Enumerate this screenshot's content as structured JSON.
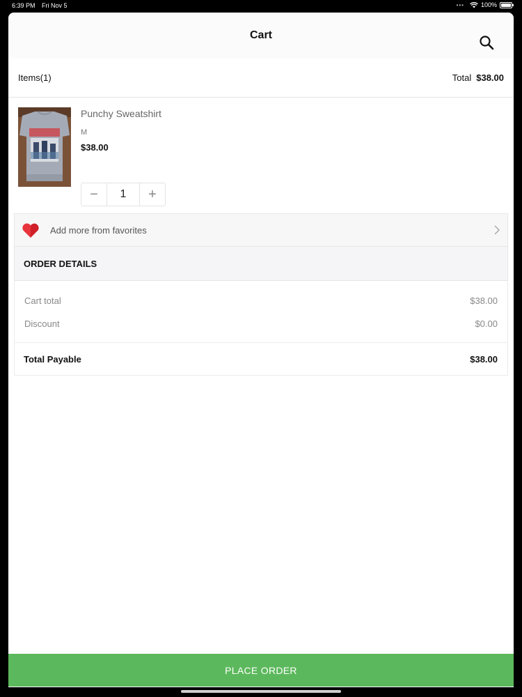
{
  "status_bar": {
    "time": "6:39 PM",
    "date": "Fri Nov 5",
    "battery": "100%",
    "battery_level": 1.0
  },
  "header": {
    "title": "Cart",
    "search_icon": "search-icon"
  },
  "summary": {
    "items_label": "Items(1)",
    "total_label": "Total",
    "total_value": "$38.00"
  },
  "cart_item": {
    "name": "Punchy Sweatshirt",
    "size": "M",
    "price": "$38.00",
    "quantity": "1",
    "decrement_symbol": "−",
    "increment_symbol": "+"
  },
  "favorites": {
    "label": "Add more from favorites",
    "icon": "heart-icon"
  },
  "order_details": {
    "heading": "ORDER DETAILS",
    "rows": [
      {
        "label": "Cart total",
        "value": "$38.00"
      },
      {
        "label": "Discount",
        "value": "$0.00"
      }
    ],
    "total_label": "Total Payable",
    "total_value": "$38.00"
  },
  "footer": {
    "place_order_label": "PLACE ORDER"
  },
  "colors": {
    "accent": "#5cb85c",
    "heart": "#d0202a"
  }
}
